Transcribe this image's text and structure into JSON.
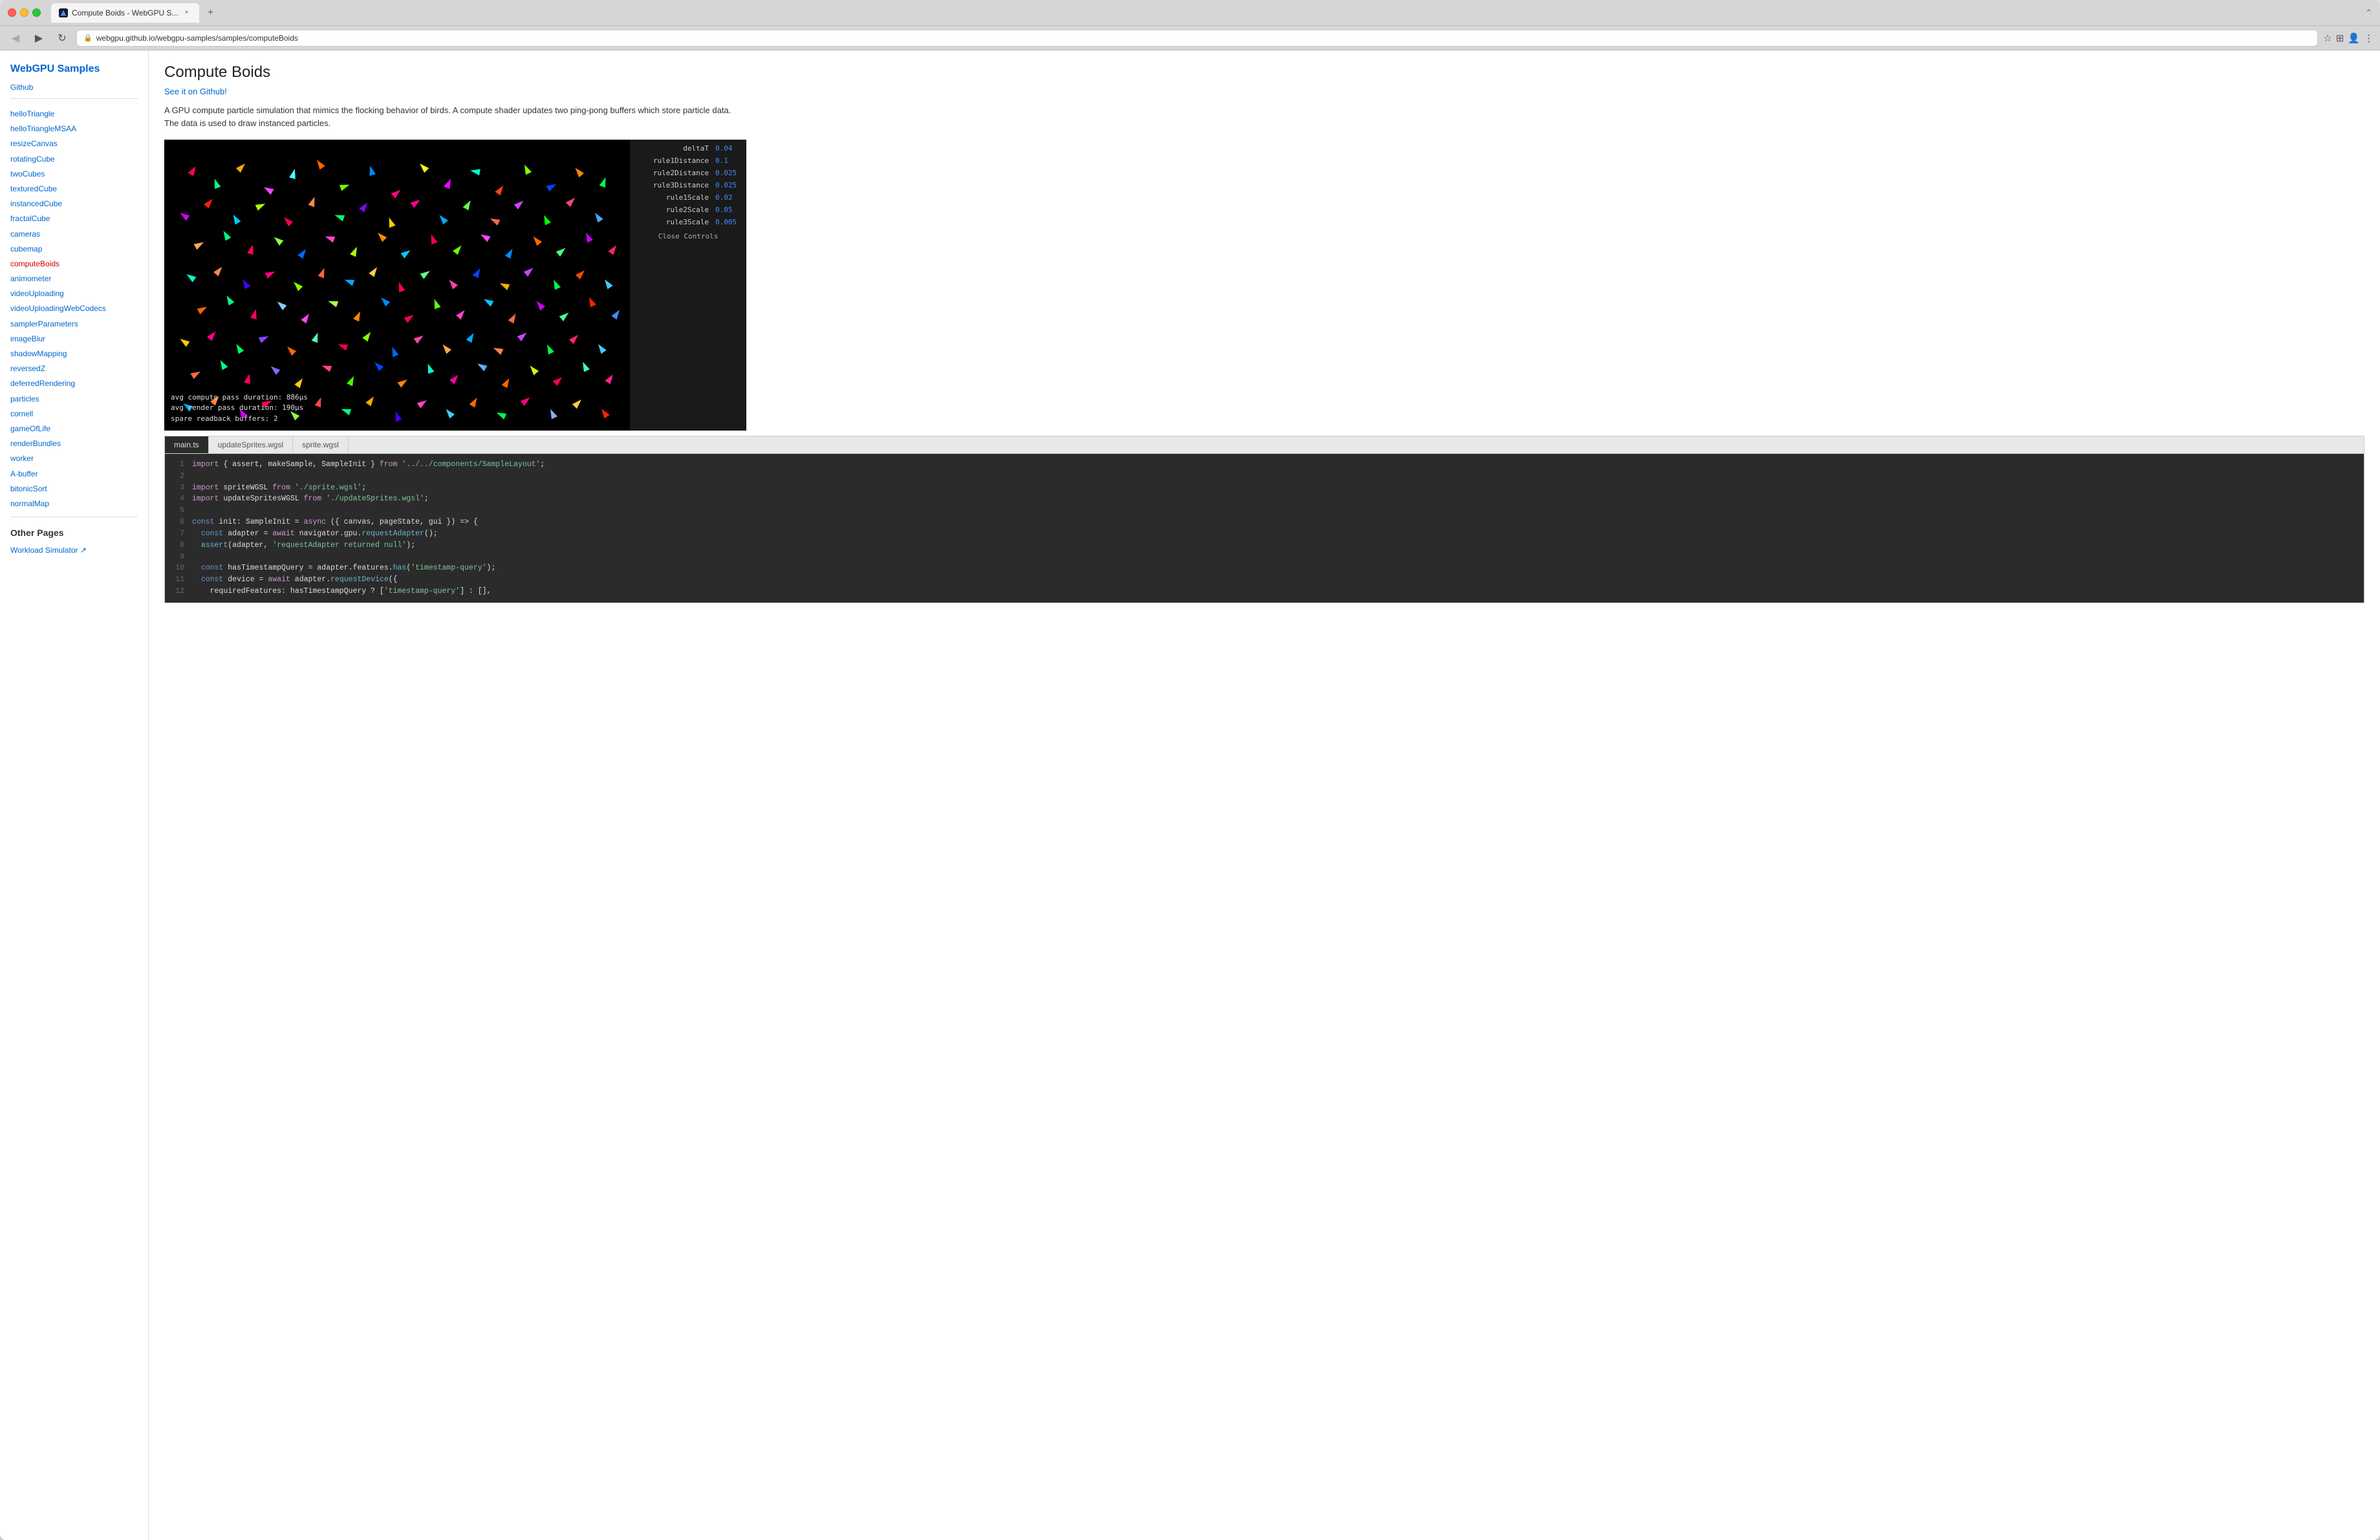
{
  "browser": {
    "tab_title": "Compute Boids - WebGPU S...",
    "url": "webgpu.github.io/webgpu-samples/samples/computeBoids",
    "new_tab_label": "+",
    "back_icon": "◀",
    "forward_icon": "▶",
    "reload_icon": "↻",
    "star_icon": "☆",
    "extensions_icon": "⊞",
    "profile_icon": "👤",
    "menu_icon": "⋮"
  },
  "sidebar": {
    "title": "WebGPU Samples",
    "github_link": "Github",
    "nav_items": [
      {
        "label": "helloTriangle",
        "active": false
      },
      {
        "label": "helloTriangleMSAA",
        "active": false
      },
      {
        "label": "resizeCanvas",
        "active": false
      },
      {
        "label": "rotatingCube",
        "active": false
      },
      {
        "label": "twoCubes",
        "active": false
      },
      {
        "label": "texturedCube",
        "active": false
      },
      {
        "label": "instancedCube",
        "active": false
      },
      {
        "label": "fractalCube",
        "active": false
      },
      {
        "label": "cameras",
        "active": false
      },
      {
        "label": "cubemap",
        "active": false
      },
      {
        "label": "computeBoids",
        "active": true
      },
      {
        "label": "animometer",
        "active": false
      },
      {
        "label": "videoUploading",
        "active": false
      },
      {
        "label": "videoUploadingWebCodecs",
        "active": false
      },
      {
        "label": "samplerParameters",
        "active": false
      },
      {
        "label": "imageBlur",
        "active": false
      },
      {
        "label": "shadowMapping",
        "active": false
      },
      {
        "label": "reversedZ",
        "active": false
      },
      {
        "label": "deferredRendering",
        "active": false
      },
      {
        "label": "particles",
        "active": false
      },
      {
        "label": "cornell",
        "active": false
      },
      {
        "label": "gameOfLife",
        "active": false
      },
      {
        "label": "renderBundles",
        "active": false
      },
      {
        "label": "worker",
        "active": false
      },
      {
        "label": "A-buffer",
        "active": false
      },
      {
        "label": "bitonicSort",
        "active": false
      },
      {
        "label": "normalMap",
        "active": false
      }
    ],
    "other_pages_title": "Other Pages",
    "other_pages": [
      {
        "label": "Workload Simulator ↗"
      }
    ]
  },
  "page": {
    "title": "Compute Boids",
    "github_link": "See it on Github!",
    "description": "A GPU compute particle simulation that mimics the flocking behavior of birds. A compute shader updates two ping-pong buffers which store particle data. The data is used to draw instanced particles."
  },
  "controls": {
    "title": "Controls",
    "params": [
      {
        "label": "deltaT",
        "value": "0.04"
      },
      {
        "label": "rule1Distance",
        "value": "0.1"
      },
      {
        "label": "rule2Distance",
        "value": "0.025"
      },
      {
        "label": "rule3Distance",
        "value": "0.025"
      },
      {
        "label": "rule1Scale",
        "value": "0.02"
      },
      {
        "label": "rule2Scale",
        "value": "0.05"
      },
      {
        "label": "rule3Scale",
        "value": "0.005"
      }
    ],
    "close_label": "Close Controls"
  },
  "stats": {
    "compute_pass": "avg compute pass duration:  886µs",
    "render_pass": "avg render pass duration:   190µs",
    "spare_buffers": "spare readback buffers:    2"
  },
  "code_tabs": [
    {
      "label": "main.ts",
      "active": true
    },
    {
      "label": "updateSprites.wgsl",
      "active": false
    },
    {
      "label": "sprite.wgsl",
      "active": false
    }
  ],
  "code_lines": [
    {
      "num": "1",
      "text": "import { assert, makeSample, SampleInit } from '../../components/SampleLayout';",
      "type": "import"
    },
    {
      "num": "2",
      "text": "",
      "type": "blank"
    },
    {
      "num": "3",
      "text": "import spriteWGSL from './sprite.wgsl';",
      "type": "import"
    },
    {
      "num": "4",
      "text": "import updateSpritesWGSL from './updateSprites.wgsl';",
      "type": "import"
    },
    {
      "num": "5",
      "text": "",
      "type": "blank"
    },
    {
      "num": "6",
      "text": "const init: SampleInit = async ({ canvas, pageState, gui }) => {",
      "type": "code"
    },
    {
      "num": "7",
      "text": "  const adapter = await navigator.gpu.requestAdapter();",
      "type": "code"
    },
    {
      "num": "8",
      "text": "  assert(adapter, 'requestAdapter returned null');",
      "type": "code"
    },
    {
      "num": "9",
      "text": "",
      "type": "blank"
    },
    {
      "num": "10",
      "text": "  const hasTimestampQuery = adapter.features.has('timestamp-query');",
      "type": "code"
    },
    {
      "num": "11",
      "text": "  const device = await adapter.requestDevice({",
      "type": "code"
    },
    {
      "num": "12",
      "text": "    requiredFeatures: hasTimestampQuery ? ['timestamp-query'] : [],",
      "type": "code"
    }
  ]
}
